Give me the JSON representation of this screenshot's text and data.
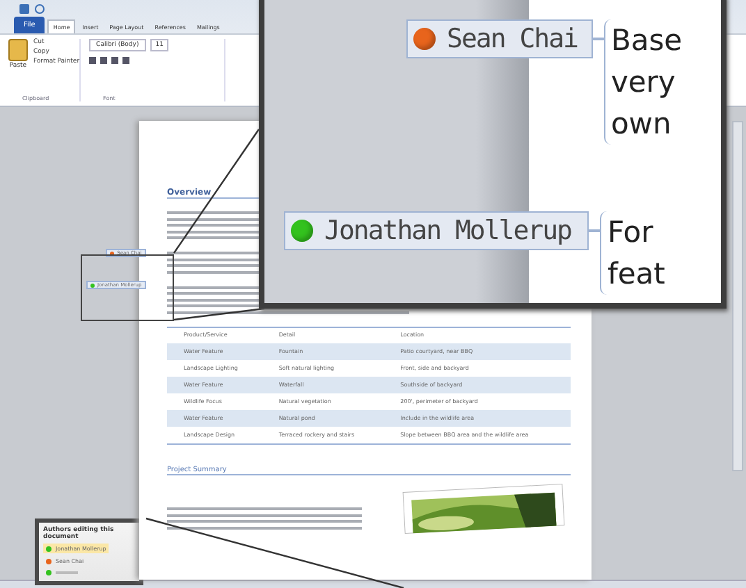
{
  "ribbon": {
    "file_tab": "File",
    "tabs": [
      {
        "label": "Home",
        "selected": true
      },
      {
        "label": "Insert",
        "selected": false
      },
      {
        "label": "Page Layout",
        "selected": false
      },
      {
        "label": "References",
        "selected": false
      },
      {
        "label": "Mailings",
        "selected": false
      }
    ],
    "paste": "Paste",
    "clipboard": [
      "Cut",
      "Copy",
      "Format Painter"
    ],
    "clipboard_group": "Clipboard",
    "font": "Calibri (Body)",
    "size": "11",
    "font_group": "Font"
  },
  "document": {
    "heading": "Overview",
    "table": {
      "columns": [
        "Product/Service",
        "Detail",
        "Location"
      ],
      "rows": [
        [
          "Water Feature",
          "Fountain",
          "Patio courtyard, near BBQ"
        ],
        [
          "Landscape Lighting",
          "Soft natural lighting",
          "Front, side and backyard"
        ],
        [
          "Water Feature",
          "Waterfall",
          "Southside of backyard"
        ],
        [
          "Wildlife Focus",
          "Natural vegetation",
          "200', perimeter of backyard"
        ],
        [
          "Water Feature",
          "Natural pond",
          "Include in the wildlife area"
        ],
        [
          "Landscape Design",
          "Terraced rockery and stairs",
          "Slope between BBQ area and the wildlife area"
        ]
      ]
    },
    "heading_2": "Project Summary"
  },
  "margin_authors": [
    {
      "name": "Sean Chai",
      "color": "#e8641c"
    },
    {
      "name": "Jonathan Mollerup",
      "color": "#33c21e"
    }
  ],
  "authors_pane": {
    "title": "Authors editing this document",
    "authors": [
      {
        "name": "Jonathan Mollerup",
        "color": "#33c21e",
        "selected": true
      },
      {
        "name": "Sean Chai",
        "color": "#e8641c",
        "selected": false
      }
    ]
  },
  "magnifier": {
    "authors": [
      {
        "name": "Sean Chai",
        "color": "#e8641c",
        "lines": [
          "Base",
          "very",
          "own"
        ]
      },
      {
        "name": "Jonathan Mollerup",
        "color": "#33c21e",
        "lines": [
          "For",
          "feat"
        ]
      }
    ]
  }
}
